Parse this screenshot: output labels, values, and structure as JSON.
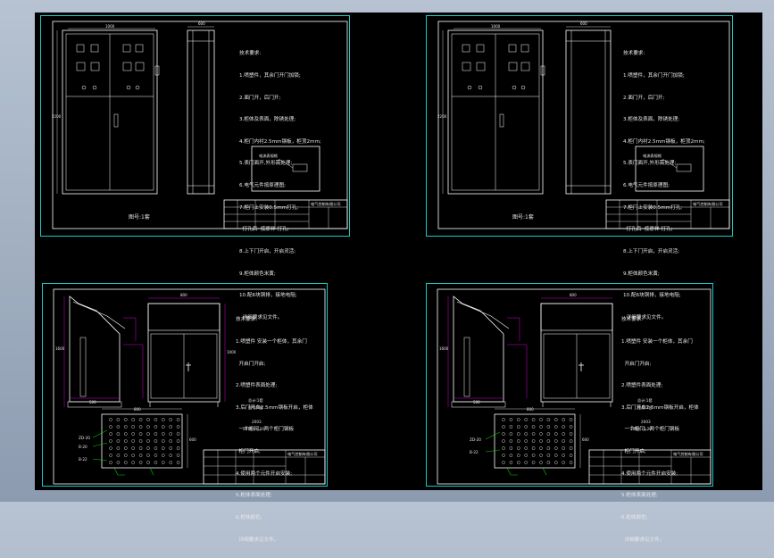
{
  "colors": {
    "background": "#000000",
    "sheet_border": "#19c7c7",
    "frame": "#ffffff",
    "dimension": "#d400d4",
    "leader": "#00d000"
  },
  "sheets": [
    {
      "notes": [
        "技术要求:",
        "1.喷塑件，其余门开门加锁;",
        "2.面门开，后门开;",
        "3.柜体及表面，除锈处理;",
        "4.柜门内衬2.5mm钢板，柜顶2mm;",
        "5.表门面开,外形需处理;",
        "6.电气元件按原理图;",
        "7.柜门上安装0.5mm打孔;",
        "  打孔后  按原样 打孔;",
        "8.上下门开启，开启灵活;",
        "9.柜体颜色米黄;",
        "10.配6块铜排，接地电阻;",
        "  详细要求见文件。"
      ],
      "inset_label": "电流表规格",
      "ref": "图号:1套",
      "company": "电气控制有限公司",
      "dims": {
        "width": "1000",
        "height": "2200",
        "depth": "600"
      }
    },
    {
      "notes": [
        "技术要求:",
        "1.喷塑件，其余门开门加锁;",
        "2.面门开，后门开;",
        "3.柜体及表面，除锈处理;",
        "4.柜门内衬2.5mm钢板，柜顶2mm;",
        "5.表门面开,外形需处理;",
        "6.电气元件按原理图;",
        "7.柜门上安装0.5mm打孔;",
        "  打孔后  按原样 打孔;",
        "8.上下门开启，开启灵活;",
        "9.柜体颜色米黄;",
        "10.配6块铜排，接地电阻;",
        "  详细要求见文件。"
      ],
      "inset_label": "电流表规格",
      "ref": "图号:1套",
      "company": "电气控制有限公司",
      "dims": {
        "width": "1000",
        "height": "2200",
        "depth": "600"
      }
    },
    {
      "notes": [
        "技术要求:",
        "1.喷塑件 安装一个柜体，其余门",
        "  开启门开启;",
        "2.喷塑件表面处理;",
        "3.后门开启2.5mm钢板开启，柜体",
        "  一个柜门，两个柜门钢板",
        "  柜门开启;",
        "4.使用两个元件开启安装;",
        "5.柜体表面处理;",
        "6.柜体颜色;",
        "  详细要求见文件。"
      ],
      "sign": "总计:1套",
      "ref": "图号:1台",
      "author": "2003",
      "date": "2010.06.10",
      "company": "电气控制有限公司",
      "callouts": [
        "ZD-20",
        "B-20",
        "B-22"
      ],
      "dims": {
        "top": "800",
        "right": "1000",
        "plate": "800",
        "bottom": "600",
        "left": "1600",
        "base": "500"
      }
    },
    {
      "notes": [
        "技术要求:",
        "1.喷塑件 安装一个柜体，其余门",
        "  开启门开启;",
        "2.喷塑件表面处理;",
        "3.后门开启2.5mm钢板开启，柜体",
        "  一个柜门，两个柜门钢板",
        "  柜门开启;",
        "4.使用两个元件开启安装;",
        "5.柜体表面处理;",
        "6.柜体颜色;",
        "  详细要求见文件。"
      ],
      "sign": "总计:1套",
      "ref": "图号:1台",
      "author": "2003",
      "date": "2010.10.20",
      "company": "电气控制有限公司",
      "callouts": [
        "ZD-20",
        "B-22"
      ],
      "dims": {
        "top": "800",
        "right": "1000",
        "plate": "800",
        "bottom": "600",
        "left": "1600",
        "base": "500"
      }
    }
  ]
}
